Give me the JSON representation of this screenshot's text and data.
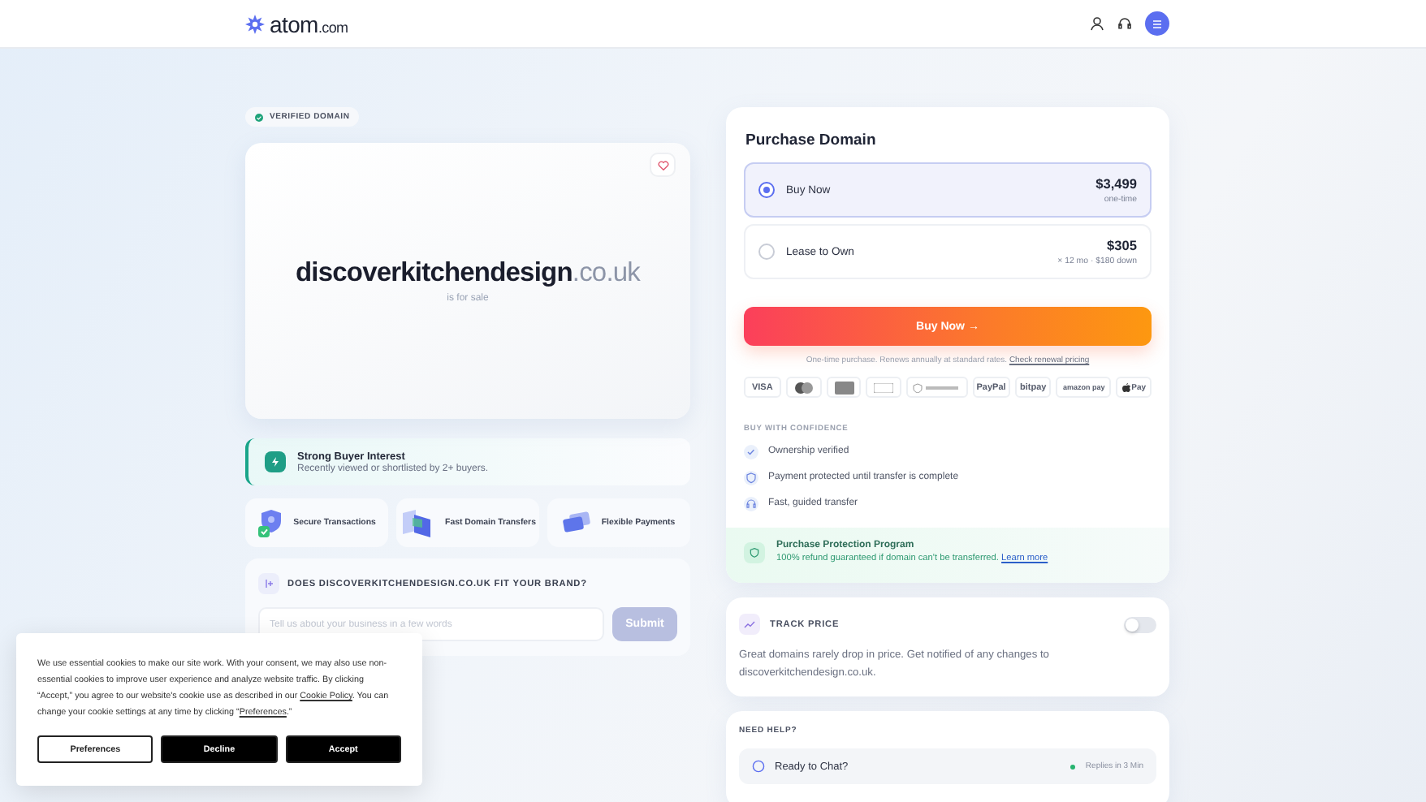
{
  "header": {
    "logo": "atom",
    "logo_suffix": ".com"
  },
  "badge": "VERIFIED DOMAIN",
  "hero": {
    "name": "discoverkitchendesign",
    "tld": ".co.uk",
    "subtitle": "is for sale",
    "favorited": false
  },
  "interest": {
    "title": "Strong Buyer Interest",
    "text": "Recently viewed or shortlisted by 2+ buyers."
  },
  "features": [
    {
      "kind": "secure",
      "label": "Secure Transactions"
    },
    {
      "kind": "fast",
      "label": "Fast Domain Transfers"
    },
    {
      "kind": "flex",
      "label": "Flexible Payments"
    }
  ],
  "brand": {
    "question": "DOES DISCOVERKITCHENDESIGN.CO.UK FIT YOUR BRAND?",
    "placeholder": "Tell us about your business in a few words",
    "button": "Submit"
  },
  "purchase": {
    "title": "Purchase Domain",
    "options": [
      {
        "label": "Buy Now",
        "price": "$3,499",
        "note": "one-time",
        "selected": true
      },
      {
        "label": "Lease to Own",
        "price": "$305",
        "note": "× 12 mo · $180 down",
        "selected": false
      }
    ],
    "button": "Buy Now",
    "button_arrow": "→",
    "fine_print": "One-time purchase. Renews annually at standard rates.",
    "fine_link": "Check renewal pricing",
    "payments": [
      {
        "kind": "text",
        "label": "VISA"
      },
      {
        "kind": "mastercard"
      },
      {
        "kind": "amex"
      },
      {
        "kind": "card"
      },
      {
        "kind": "escrow"
      },
      {
        "kind": "text",
        "label": "PayPal"
      },
      {
        "kind": "text",
        "label": "bitpay"
      },
      {
        "kind": "text",
        "label": "amazon pay"
      },
      {
        "kind": "apple",
        "label": "Pay"
      }
    ],
    "confidence_title": "BUY WITH CONFIDENCE",
    "confidence": [
      {
        "kind": "check",
        "label": "Ownership verified"
      },
      {
        "kind": "shield",
        "label": "Payment protected until transfer is complete"
      },
      {
        "kind": "headset",
        "label": "Fast, guided transfer"
      }
    ],
    "protection": {
      "title": "Purchase Protection Program",
      "text": "100% refund guaranteed if domain can't be transferred.",
      "link": "Learn more"
    }
  },
  "track": {
    "title": "TRACK PRICE",
    "on": false,
    "text": "Great domains rarely drop in price. Get notified of any changes to discoverkitchendesign.co.uk."
  },
  "help": {
    "title": "NEED HELP?",
    "chat": "Ready to Chat?",
    "status": "Replies in 3 Min"
  },
  "cookie": {
    "text": "We use essential cookies to make our site work. With your consent, we may also use non-essential cookies to improve user experience and analyze website traffic. By clicking “Accept,” you agree to our website's cookie use as described in our ",
    "policy_link": "Cookie Policy",
    "text2": ". You can change your cookie settings at any time by clicking “",
    "pref_link": "Preferences",
    "text3": ".”",
    "buttons": [
      {
        "kind": "outline",
        "label": "Preferences"
      },
      {
        "kind": "solid",
        "label": "Decline"
      },
      {
        "kind": "solid",
        "label": "Accept"
      }
    ]
  }
}
